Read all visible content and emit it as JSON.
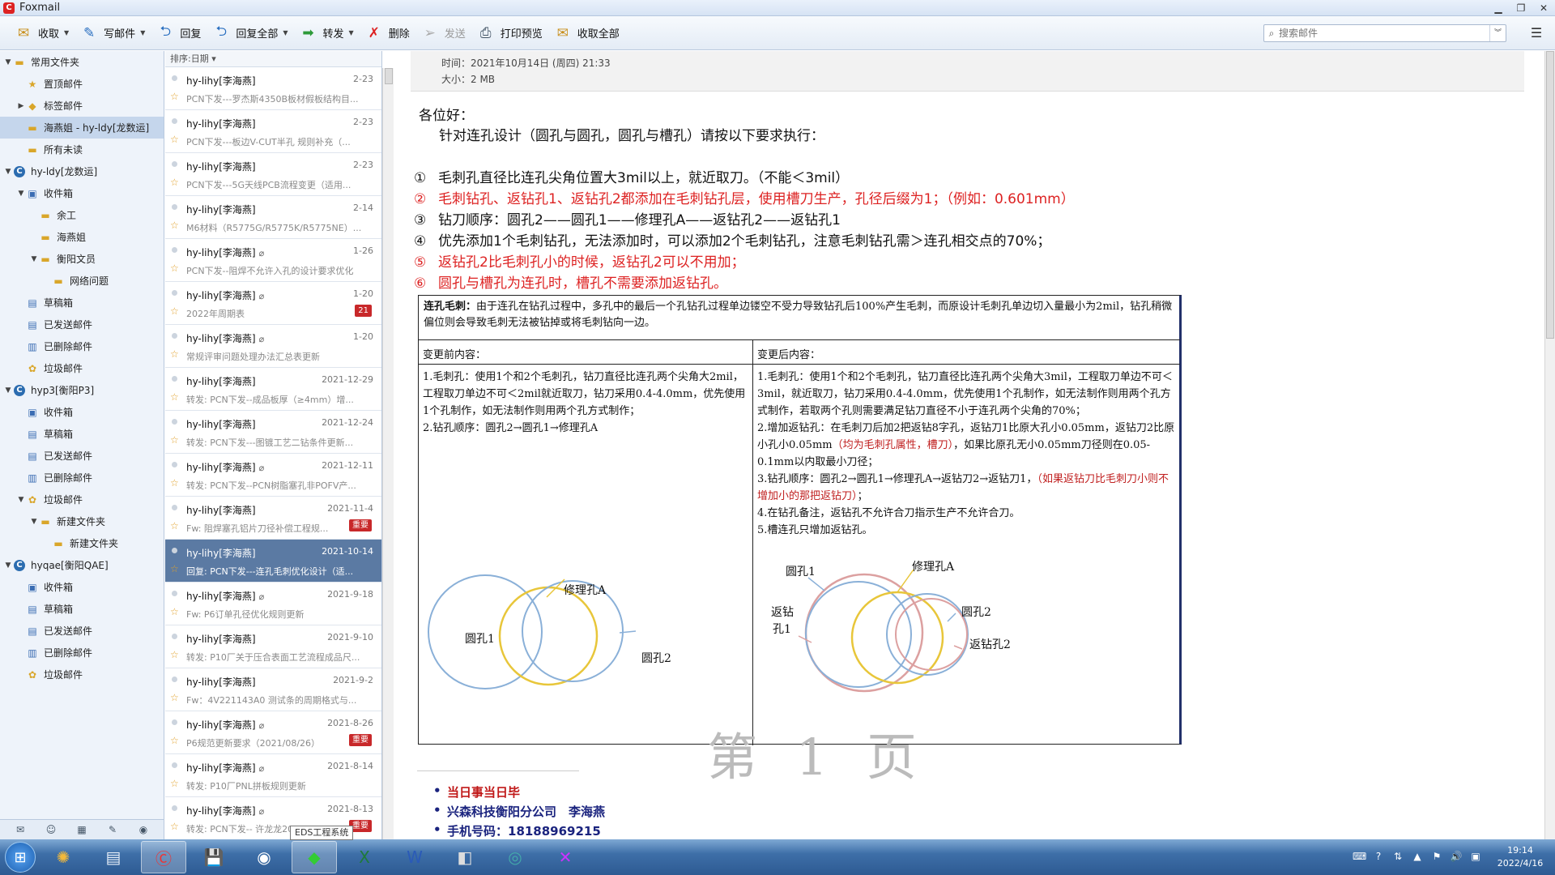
{
  "window": {
    "title": "Foxmail"
  },
  "toolbar": {
    "receive": "收取",
    "compose": "写邮件",
    "reply": "回复",
    "reply_all": "回复全部",
    "forward": "转发",
    "delete": "删除",
    "send": "发送",
    "print_preview": "打印预览",
    "receive_all": "收取全部",
    "search_placeholder": "搜索邮件"
  },
  "folders": [
    {
      "label": "常用文件夹",
      "level": 0,
      "arrow": "▼",
      "icon": "folder"
    },
    {
      "label": "置顶邮件",
      "level": 1,
      "arrow": "",
      "icon": "star"
    },
    {
      "label": "标签邮件",
      "level": 1,
      "arrow": "▶",
      "icon": "tag"
    },
    {
      "label": "海燕姐 - hy-ldy[龙数运]",
      "level": 1,
      "arrow": "",
      "icon": "folder",
      "selected": true
    },
    {
      "label": "所有未读",
      "level": 1,
      "arrow": "",
      "icon": "folder"
    },
    {
      "label": "hy-ldy[龙数运]",
      "level": 0,
      "arrow": "▼",
      "icon": "account"
    },
    {
      "label": "收件箱",
      "level": 1,
      "arrow": "▼",
      "icon": "inbox"
    },
    {
      "label": "余工",
      "level": 2,
      "arrow": "",
      "icon": "folder"
    },
    {
      "label": "海燕姐",
      "level": 2,
      "arrow": "",
      "icon": "folder"
    },
    {
      "label": "衡阳文员",
      "level": 2,
      "arrow": "▼",
      "icon": "folder"
    },
    {
      "label": "网络问题",
      "level": 3,
      "arrow": "",
      "icon": "folder"
    },
    {
      "label": "草稿箱",
      "level": 1,
      "arrow": "",
      "icon": "draft"
    },
    {
      "label": "已发送邮件",
      "level": 1,
      "arrow": "",
      "icon": "sent"
    },
    {
      "label": "已删除邮件",
      "level": 1,
      "arrow": "",
      "icon": "trash"
    },
    {
      "label": "垃圾邮件",
      "level": 1,
      "arrow": "",
      "icon": "spam"
    },
    {
      "label": "hyp3[衡阳P3]",
      "level": 0,
      "arrow": "▼",
      "icon": "account"
    },
    {
      "label": "收件箱",
      "level": 1,
      "arrow": "",
      "icon": "inbox"
    },
    {
      "label": "草稿箱",
      "level": 1,
      "arrow": "",
      "icon": "draft"
    },
    {
      "label": "已发送邮件",
      "level": 1,
      "arrow": "",
      "icon": "sent"
    },
    {
      "label": "已删除邮件",
      "level": 1,
      "arrow": "",
      "icon": "trash"
    },
    {
      "label": "垃圾邮件",
      "level": 1,
      "arrow": "▼",
      "icon": "spam"
    },
    {
      "label": "新建文件夹",
      "level": 2,
      "arrow": "▼",
      "icon": "folder"
    },
    {
      "label": "新建文件夹",
      "level": 3,
      "arrow": "",
      "icon": "folder"
    },
    {
      "label": "hyqae[衡阳QAE]",
      "level": 0,
      "arrow": "▼",
      "icon": "account"
    },
    {
      "label": "收件箱",
      "level": 1,
      "arrow": "",
      "icon": "inbox"
    },
    {
      "label": "草稿箱",
      "level": 1,
      "arrow": "",
      "icon": "draft"
    },
    {
      "label": "已发送邮件",
      "level": 1,
      "arrow": "",
      "icon": "sent"
    },
    {
      "label": "已删除邮件",
      "level": 1,
      "arrow": "",
      "icon": "trash"
    },
    {
      "label": "垃圾邮件",
      "level": 1,
      "arrow": "",
      "icon": "spam"
    }
  ],
  "msglist": {
    "sort_label": "排序:日期 ▾",
    "messages": [
      {
        "from": "hy-lihy[李海燕]",
        "date": "2-23",
        "subject": "PCN下发---罗杰斯4350B板材假板结构目...",
        "clip": false,
        "badge": ""
      },
      {
        "from": "hy-lihy[李海燕]",
        "date": "2-23",
        "subject": "PCN下发---板边V-CUT半孔 规则补充（...",
        "clip": false,
        "badge": ""
      },
      {
        "from": "hy-lihy[李海燕]",
        "date": "2-23",
        "subject": "PCN下发---5G天线PCB流程变更（适用...",
        "clip": false,
        "badge": ""
      },
      {
        "from": "hy-lihy[李海燕]",
        "date": "2-14",
        "subject": "M6材料（R5775G/R5775K/R5775NE）...",
        "clip": false,
        "badge": ""
      },
      {
        "from": "hy-lihy[李海燕]",
        "date": "1-26",
        "subject": "PCN下发--阻焊不允许入孔的设计要求优化",
        "clip": true,
        "badge": ""
      },
      {
        "from": "hy-lihy[李海燕]",
        "date": "1-20",
        "subject": "2022年周期表",
        "clip": true,
        "badge": "21"
      },
      {
        "from": "hy-lihy[李海燕]",
        "date": "1-20",
        "subject": "常规评审问题处理办法汇总表更新",
        "clip": true,
        "badge": ""
      },
      {
        "from": "hy-lihy[李海燕]",
        "date": "2021-12-29",
        "subject": "转发: PCN下发--成品板厚（≥4mm）增...",
        "clip": false,
        "badge": ""
      },
      {
        "from": "hy-lihy[李海燕]",
        "date": "2021-12-24",
        "subject": "转发: PCN下发---图镀工艺二钻条件更新...",
        "clip": false,
        "badge": ""
      },
      {
        "from": "hy-lihy[李海燕]",
        "date": "2021-12-11",
        "subject": "转发: PCN下发--PCN树脂塞孔非POFV产...",
        "clip": true,
        "badge": ""
      },
      {
        "from": "hy-lihy[李海燕]",
        "date": "2021-11-4",
        "subject": "Fw: 阻焊塞孔铝片刀径补偿工程规...",
        "clip": false,
        "badge": "重要"
      },
      {
        "from": "hy-lihy[李海燕]",
        "date": "2021-10-14",
        "subject": "回复: PCN下发---连孔毛刺优化设计（适...",
        "clip": false,
        "badge": "",
        "selected": true
      },
      {
        "from": "hy-lihy[李海燕]",
        "date": "2021-9-18",
        "subject": "Fw: P6订单孔径优化规则更新",
        "clip": true,
        "badge": ""
      },
      {
        "from": "hy-lihy[李海燕]",
        "date": "2021-9-10",
        "subject": "转发: P10厂关于压合表面工艺流程成品尺...",
        "clip": false,
        "badge": ""
      },
      {
        "from": "hy-lihy[李海燕]",
        "date": "2021-9-2",
        "subject": "Fw：4V221143A0 测试条的周期格式与...",
        "clip": false,
        "badge": ""
      },
      {
        "from": "hy-lihy[李海燕]",
        "date": "2021-8-26",
        "subject": "P6规范更新要求（2021/08/26）",
        "clip": true,
        "badge": "重要"
      },
      {
        "from": "hy-lihy[李海燕]",
        "date": "2021-8-14",
        "subject": "转发: P10厂PNL拼板规则更新",
        "clip": true,
        "badge": ""
      },
      {
        "from": "hy-lihy[李海燕]",
        "date": "2021-8-13",
        "subject": "转发: PCN下发-- 许龙龙2021-08-0...",
        "clip": true,
        "badge": "重要"
      }
    ]
  },
  "email": {
    "time_line": "时间：2021年10月14日 (周四) 21:33",
    "size_line": "大小：2 MB",
    "greeting": "各位好：",
    "intro": "针对连孔设计（圆孔与圆孔，圆孔与槽孔）请按以下要求执行：",
    "rules": [
      {
        "num": "①",
        "text": "毛刺孔直径比连孔尖角位置大3mil以上，就近取刀。（不能＜3mil）",
        "red": false
      },
      {
        "num": "②",
        "text": "毛刺钻孔、返钻孔1、返钻孔2都添加在毛刺钻孔层，使用槽刀生产，孔径后缀为1；（例如：0.601mm）",
        "red": true
      },
      {
        "num": "③",
        "text": "钻刀顺序：圆孔2——圆孔1——修理孔A——返钻孔2——返钻孔1",
        "red": false
      },
      {
        "num": "④",
        "text": "优先添加1个毛刺钻孔，无法添加时，可以添加2个毛刺钻孔，注意毛刺钻孔需＞连孔相交点的70%；",
        "red": false
      },
      {
        "num": "⑤",
        "text": "返钻孔2比毛刺孔小的时候，返钻孔2可以不用加；",
        "red": true
      },
      {
        "num": "⑥",
        "text": "圆孔与槽孔为连孔时，槽孔不需要添加返钻孔。",
        "red": true
      }
    ],
    "table": {
      "title_bold": "连孔毛刺：",
      "title_text": "由于连孔在钻孔过程中，多孔中的最后一个孔钻孔过程单边镂空不受力导致钻孔后100%产生毛刺，而原设计毛刺孔单边切入量最小为2mil，钻孔稍微偏位则会导致毛刺无法被钻掉或将毛刺钻向一边。",
      "before_header": "变更前内容：",
      "after_header": "变更后内容：",
      "before_1": "1.毛刺孔：使用1个和2个毛刺孔，钻刀直径比连孔两个尖角大2mil，工程取刀单边不可＜2mil就近取刀，钻刀采用0.4-4.0mm，优先使用1个孔制作，如无法制作则用两个孔方式制作；",
      "before_2": "2.钻孔顺序：圆孔2→圆孔1→修理孔A",
      "after_1": "1.毛刺孔：使用1个和2个毛刺孔，钻刀直径比连孔两个尖角大3mil，工程取刀单边不可＜3mil，就近取刀，钻刀采用0.4-4.0mm，优先使用1个孔制作，如无法制作则用两个孔方式制作，若取两个孔则需要满足钻刀直径不小于连孔两个尖角的70%；",
      "after_2a": "2.增加返钻孔：在毛刺刀后加2把返钻8字孔，返钻刀1比原大孔小0.05mm，返钻刀2比原小孔小0.05mm",
      "after_2red": "（均为毛刺孔属性，槽刀）",
      "after_2b": "，如果比原孔无小0.05mm刀径则在0.05-0.1mm以内取最小刀径；",
      "after_3a": "3.钻孔顺序：圆孔2→圆孔1→修理孔A→返钻刀2→返钻刀1，",
      "after_3red": "（如果返钻刀比毛刺刀小则不增加小的那把返钻刀）",
      "after_3b": "；",
      "after_4": "4.在钻孔备注，返钻孔不允许合刀指示生产不允许合刀。",
      "after_5": "5.槽连孔只增加返钻孔。",
      "lbl_repair_a": "修理孔A",
      "lbl_circle1": "圆孔1",
      "lbl_circle2": "圆孔2",
      "lbl_circle1_r": "圆孔1",
      "lbl_repair_a_r": "修理孔A",
      "lbl_return1_a": "返钻",
      "lbl_return1_b": "孔1",
      "lbl_circle2_r": "圆孔2",
      "lbl_return2": "返钻孔2",
      "watermark": "第 1 页"
    },
    "signature": [
      {
        "text": "当日事当日毕",
        "red": true
      },
      {
        "text": "兴森科技衡阳分公司　李海燕",
        "red": false
      },
      {
        "text": "手机号码：18188969215",
        "red": false
      }
    ]
  },
  "taskbar": {
    "tooltip": "EDS工程系统",
    "time": "19:14",
    "date": "2022/4/16"
  }
}
